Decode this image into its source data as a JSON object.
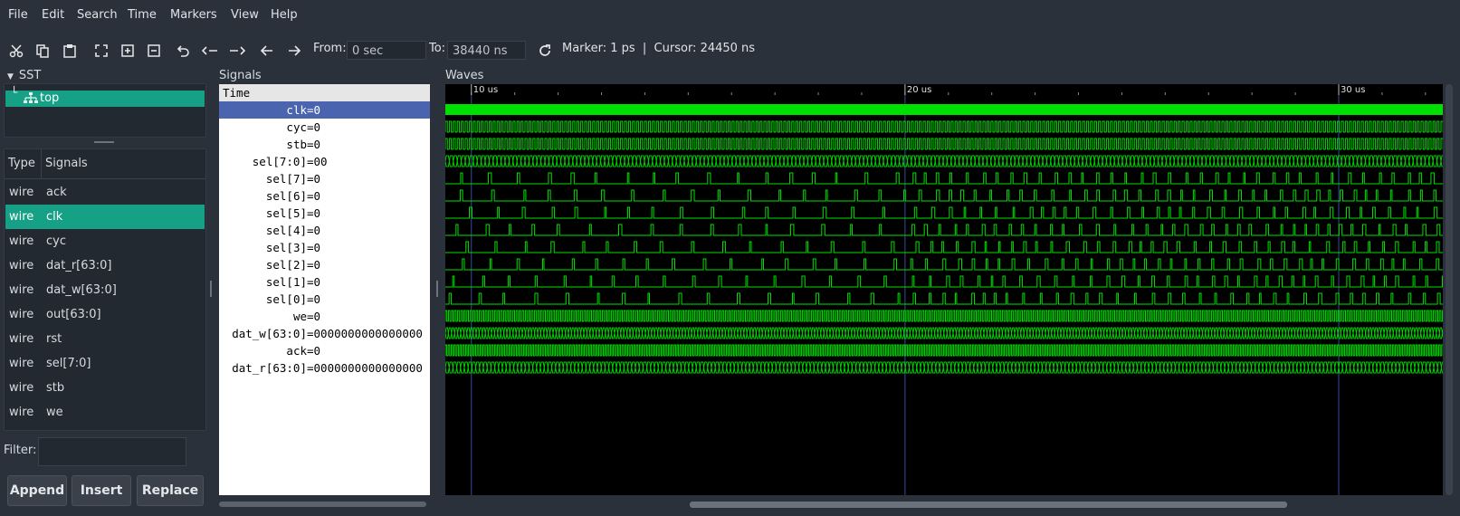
{
  "menu": [
    "File",
    "Edit",
    "Search",
    "Time",
    "Markers",
    "View",
    "Help"
  ],
  "toolbar": {
    "icons": [
      "cut-icon",
      "copy-icon",
      "paste-icon",
      "zoom-fit-icon",
      "zoom-in-icon",
      "zoom-out-icon",
      "undo-icon",
      "zoom-to-start-icon",
      "zoom-to-end-icon",
      "previous-edge-icon",
      "next-edge-icon"
    ],
    "from_label": "From:",
    "from_value": "0 sec",
    "to_label": "To:",
    "to_value": "38440 ns",
    "reload_icon": "reload-icon",
    "status": "Marker: 1 ps  |  Cursor: 24450 ns"
  },
  "sst": {
    "title": "SST",
    "tree_item": "top"
  },
  "signal_table": {
    "col_type": "Type",
    "col_signals": "Signals",
    "rows": [
      {
        "type": "wire",
        "name": "ack"
      },
      {
        "type": "wire",
        "name": "clk"
      },
      {
        "type": "wire",
        "name": "cyc"
      },
      {
        "type": "wire",
        "name": "dat_r[63:0]"
      },
      {
        "type": "wire",
        "name": "dat_w[63:0]"
      },
      {
        "type": "wire",
        "name": "out[63:0]"
      },
      {
        "type": "wire",
        "name": "rst"
      },
      {
        "type": "wire",
        "name": "sel[7:0]"
      },
      {
        "type": "wire",
        "name": "stb"
      },
      {
        "type": "wire",
        "name": "we"
      }
    ],
    "selected_index": 1
  },
  "filter": {
    "label": "Filter:",
    "value": ""
  },
  "buttons": {
    "append": "Append",
    "insert": "Insert",
    "replace": "Replace"
  },
  "signals_pane": {
    "title": "Signals",
    "time_label": "Time",
    "rows": [
      {
        "name": "clk",
        "value": "=0",
        "highlight": true
      },
      {
        "name": "cyc",
        "value": "=0"
      },
      {
        "name": "stb",
        "value": "=0"
      },
      {
        "name": "sel[7:0]",
        "value": "=00"
      },
      {
        "name": "sel[7]",
        "value": "=0"
      },
      {
        "name": "sel[6]",
        "value": "=0"
      },
      {
        "name": "sel[5]",
        "value": "=0"
      },
      {
        "name": "sel[4]",
        "value": "=0"
      },
      {
        "name": "sel[3]",
        "value": "=0"
      },
      {
        "name": "sel[2]",
        "value": "=0"
      },
      {
        "name": "sel[1]",
        "value": "=0"
      },
      {
        "name": "sel[0]",
        "value": "=0"
      },
      {
        "name": "we",
        "value": "=0"
      },
      {
        "name": "dat_w[63:0]",
        "value": "=0000000000000000"
      },
      {
        "name": "ack",
        "value": "=0"
      },
      {
        "name": "dat_r[63:0]",
        "value": "=0000000000000000"
      }
    ]
  },
  "waves": {
    "title": "Waves",
    "time_ticks": [
      {
        "label": "10 us",
        "t": 10
      },
      {
        "label": "20 us",
        "t": 20
      },
      {
        "label": "30 us",
        "t": 30
      }
    ],
    "visible_range_us": [
      9.4,
      32.4
    ],
    "colors": {
      "wave": "#00e000",
      "bus": "#00d000",
      "background": "#000000",
      "grid": "#3a4a9a"
    }
  }
}
